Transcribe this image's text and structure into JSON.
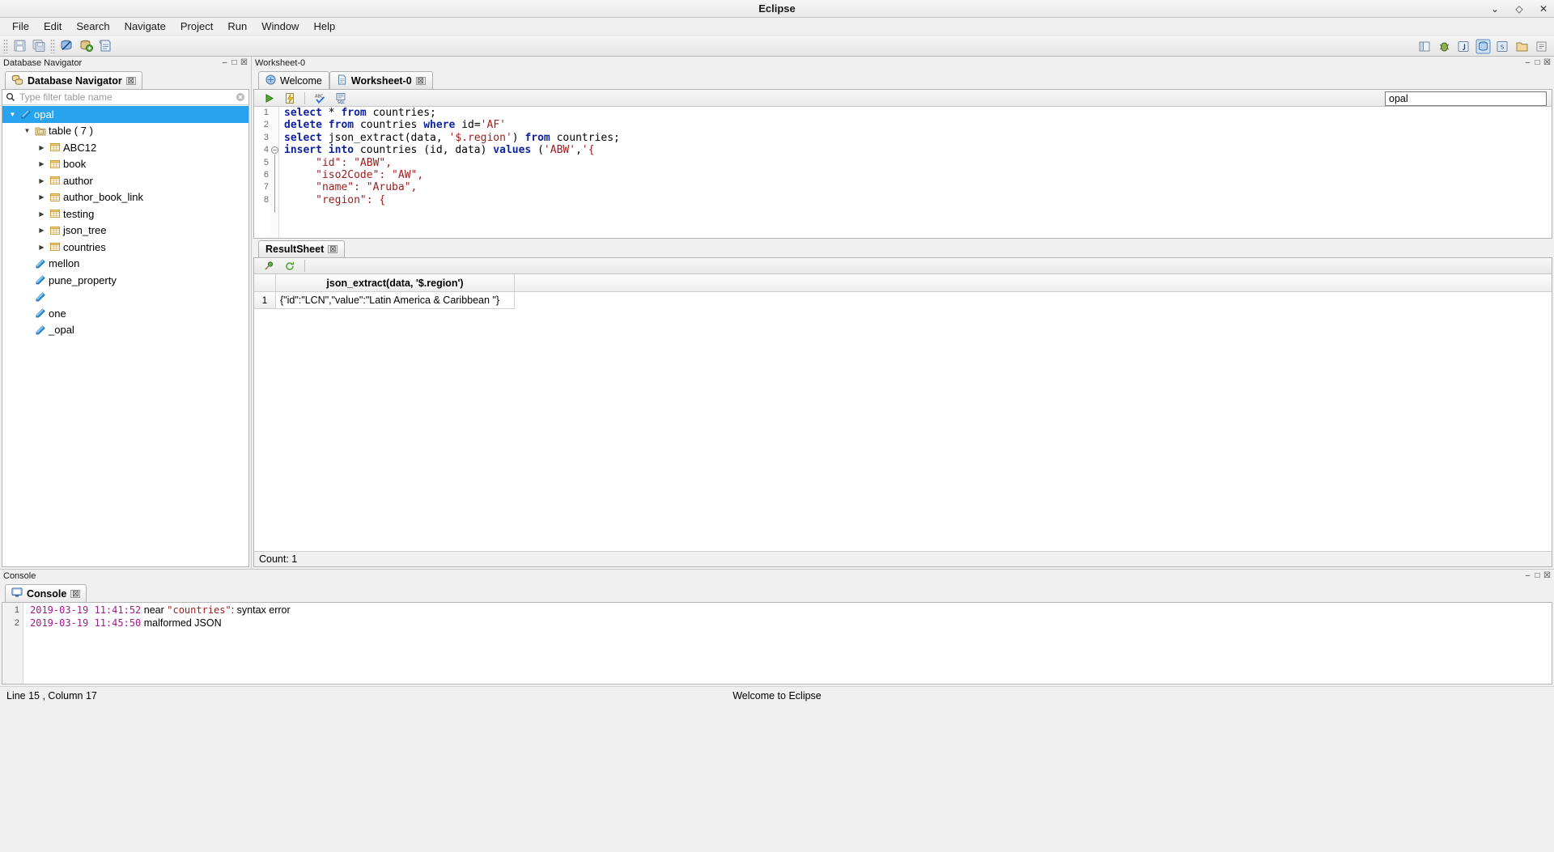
{
  "window": {
    "title": "Eclipse",
    "buttons": [
      {
        "name": "minimize",
        "glyph": "⌄"
      },
      {
        "name": "maximize",
        "glyph": "◇"
      },
      {
        "name": "close",
        "glyph": "✕"
      }
    ]
  },
  "menubar": {
    "items": [
      "File",
      "Edit",
      "Search",
      "Navigate",
      "Project",
      "Run",
      "Window",
      "Help"
    ]
  },
  "toolbar": {
    "left_icons": [
      "save-icon",
      "save-all-icon",
      "disconnect-database-icon",
      "add-database-icon",
      "new-sql-worksheet-icon"
    ],
    "right_icons": [
      "open-perspective-icon",
      "debug-perspective-icon",
      "java-perspective-icon",
      "database-perspective-icon",
      "sql-perspective-icon",
      "resource-perspective-icon",
      "quick-access-icon"
    ]
  },
  "navigator": {
    "view_title": "Database Navigator",
    "tab_label": "Database Navigator",
    "tab_icon": "database-stack-icon",
    "close_glyph": "☒",
    "view_buttons": [
      "minimize-view",
      "maximize-view",
      "close-view"
    ],
    "filter": {
      "icon": "search-icon",
      "value": "",
      "placeholder": "Type filter table name",
      "clear_icon": "clear-icon"
    },
    "tree": [
      {
        "label": "opal",
        "icon": "connection-icon",
        "indent": 0,
        "twisty": "down",
        "selected": true
      },
      {
        "label": "table ( 7 )",
        "icon": "folder-table-icon",
        "indent": 1,
        "twisty": "down",
        "selected": false
      },
      {
        "label": "ABC12",
        "icon": "table-icon",
        "indent": 2,
        "twisty": "right",
        "selected": false
      },
      {
        "label": "book",
        "icon": "table-icon",
        "indent": 2,
        "twisty": "right",
        "selected": false
      },
      {
        "label": "author",
        "icon": "table-icon",
        "indent": 2,
        "twisty": "right",
        "selected": false
      },
      {
        "label": "author_book_link",
        "icon": "table-icon",
        "indent": 2,
        "twisty": "right",
        "selected": false
      },
      {
        "label": "testing",
        "icon": "table-icon",
        "indent": 2,
        "twisty": "right",
        "selected": false
      },
      {
        "label": "json_tree",
        "icon": "table-icon",
        "indent": 2,
        "twisty": "right",
        "selected": false
      },
      {
        "label": "countries",
        "icon": "table-icon",
        "indent": 2,
        "twisty": "right",
        "selected": false
      },
      {
        "label": "mellon",
        "icon": "connection-icon",
        "indent": 1,
        "twisty": "none",
        "selected": false
      },
      {
        "label": "pune_property",
        "icon": "connection-icon",
        "indent": 1,
        "twisty": "none",
        "selected": false
      },
      {
        "label": "",
        "icon": "connection-icon",
        "indent": 1,
        "twisty": "none",
        "selected": false
      },
      {
        "label": "one",
        "icon": "connection-icon",
        "indent": 1,
        "twisty": "none",
        "selected": false
      },
      {
        "label": "_opal",
        "icon": "connection-icon",
        "indent": 1,
        "twisty": "none",
        "selected": false
      }
    ]
  },
  "editor": {
    "view_title": "Worksheet-0",
    "view_buttons": [
      "minimize-view",
      "maximize-view",
      "close-view"
    ],
    "tabs": [
      {
        "label": "Welcome",
        "icon": "welcome-icon",
        "active": false,
        "closable": false
      },
      {
        "label": "Worksheet-0",
        "icon": "sql-file-icon",
        "active": true,
        "closable": true
      }
    ],
    "close_glyph": "☒",
    "toolbar_icons": [
      "execute-icon",
      "execute-script-icon",
      "spellcheck-icon",
      "format-sql-icon"
    ],
    "connection_combo": "opal",
    "lines": [
      {
        "num": 1,
        "fold": false,
        "tokens": [
          {
            "t": "select ",
            "c": "kw"
          },
          {
            "t": "* ",
            "c": "pl"
          },
          {
            "t": "from ",
            "c": "kw"
          },
          {
            "t": "countries;",
            "c": "pl"
          }
        ]
      },
      {
        "num": 2,
        "fold": false,
        "tokens": [
          {
            "t": "delete ",
            "c": "kw"
          },
          {
            "t": "from ",
            "c": "kw"
          },
          {
            "t": "countries ",
            "c": "pl"
          },
          {
            "t": "where ",
            "c": "kw"
          },
          {
            "t": "id=",
            "c": "pl"
          },
          {
            "t": "'AF'",
            "c": "str"
          }
        ]
      },
      {
        "num": 3,
        "fold": false,
        "tokens": [
          {
            "t": "select ",
            "c": "kw"
          },
          {
            "t": "json_extract(data, ",
            "c": "pl"
          },
          {
            "t": "'$.region'",
            "c": "str"
          },
          {
            "t": ") ",
            "c": "pl"
          },
          {
            "t": "from ",
            "c": "kw"
          },
          {
            "t": "countries;",
            "c": "pl"
          }
        ]
      },
      {
        "num": 4,
        "fold": true,
        "tokens": [
          {
            "t": "insert into ",
            "c": "kw"
          },
          {
            "t": "countries (id, data) ",
            "c": "pl"
          },
          {
            "t": "values ",
            "c": "kw"
          },
          {
            "t": "(",
            "c": "pl"
          },
          {
            "t": "'ABW'",
            "c": "str"
          },
          {
            "t": ",",
            "c": "pl"
          },
          {
            "t": "'{",
            "c": "str"
          }
        ]
      },
      {
        "num": 5,
        "fold": false,
        "tokens": [
          {
            "t": "     \"id\": \"ABW\",",
            "c": "str"
          }
        ]
      },
      {
        "num": 6,
        "fold": false,
        "tokens": [
          {
            "t": "     \"iso2Code\": \"AW\",",
            "c": "str"
          }
        ]
      },
      {
        "num": 7,
        "fold": false,
        "tokens": [
          {
            "t": "     \"name\": \"Aruba\",",
            "c": "str"
          }
        ]
      },
      {
        "num": 8,
        "fold": false,
        "tokens": [
          {
            "t": "     \"region\": {",
            "c": "str"
          }
        ]
      }
    ]
  },
  "result": {
    "tab_label": "ResultSheet",
    "close_glyph": "☒",
    "toolbar_icons": [
      "pin-result-icon",
      "refresh-result-icon"
    ],
    "columns": [
      "json_extract(data, '$.region')"
    ],
    "rows": [
      {
        "num": "1",
        "cells": [
          "{\"id\":\"LCN\",\"value\":\"Latin America & Caribbean \"}"
        ]
      }
    ],
    "status": "Count: 1"
  },
  "console": {
    "view_title": "Console",
    "tab_label": "Console",
    "tab_icon": "console-icon",
    "close_glyph": "☒",
    "view_buttons": [
      "minimize-view",
      "maximize-view",
      "close-view"
    ],
    "lines": [
      {
        "num": "1",
        "timestamp": "2019-03-19 11:41:52",
        "mid": " near ",
        "ident": "\"countries\"",
        "tail": ": syntax error"
      },
      {
        "num": "2",
        "timestamp": "2019-03-19 11:45:50",
        "mid": " malformed JSON",
        "ident": "",
        "tail": ""
      }
    ]
  },
  "statusbar": {
    "position": "Line 15 , Column 17",
    "message": "Welcome to Eclipse"
  }
}
